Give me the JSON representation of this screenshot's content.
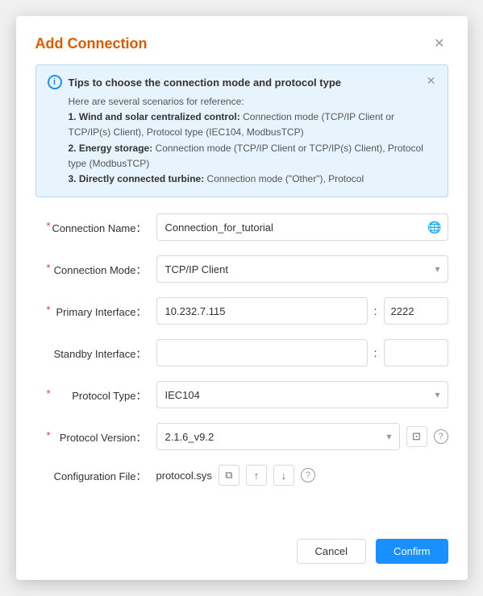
{
  "dialog": {
    "title": "Add Connection",
    "close_label": "✕"
  },
  "tip": {
    "title": "Tips to choose the connection mode and protocol type",
    "intro": "Here are several scenarios for reference:",
    "items": [
      {
        "label": "1. Wind and solar centralized control:",
        "text": " Connection mode (TCP/IP Client or TCP/IP(s) Client), Protocol type (IEC104, ModbusTCP)"
      },
      {
        "label": "2. Energy storage:",
        "text": " Connection mode (TCP/IP Client or TCP/IP(s) Client), Protocol type (ModbusTCP)"
      },
      {
        "label": "3. Directly connected turbine:",
        "text": " Connection mode (\"Other\"), Protocol"
      }
    ],
    "close_label": "✕"
  },
  "form": {
    "connection_name_label": "Connection Name：",
    "connection_name_value": "Connection_for_tutorial",
    "connection_mode_label": "Connection Mode：",
    "connection_mode_value": "TCP/IP Client",
    "primary_interface_label": "Primary Interface：",
    "primary_ip": "10.232.7.115",
    "primary_port": "2222",
    "standby_interface_label": "Standby Interface：",
    "standby_ip": "",
    "standby_port": "",
    "protocol_type_label": "Protocol Type：",
    "protocol_type_value": "IEC104",
    "protocol_version_label": "Protocol Version：",
    "protocol_version_value": "2.1.6_v9.2",
    "config_file_label": "Configuration File：",
    "config_filename": "protocol.sys"
  },
  "footer": {
    "cancel_label": "Cancel",
    "confirm_label": "Confirm"
  },
  "icons": {
    "globe": "🌐",
    "info": "i",
    "help": "?",
    "save": "💾",
    "upload": "↑",
    "download": "↓",
    "file_help": "?"
  }
}
